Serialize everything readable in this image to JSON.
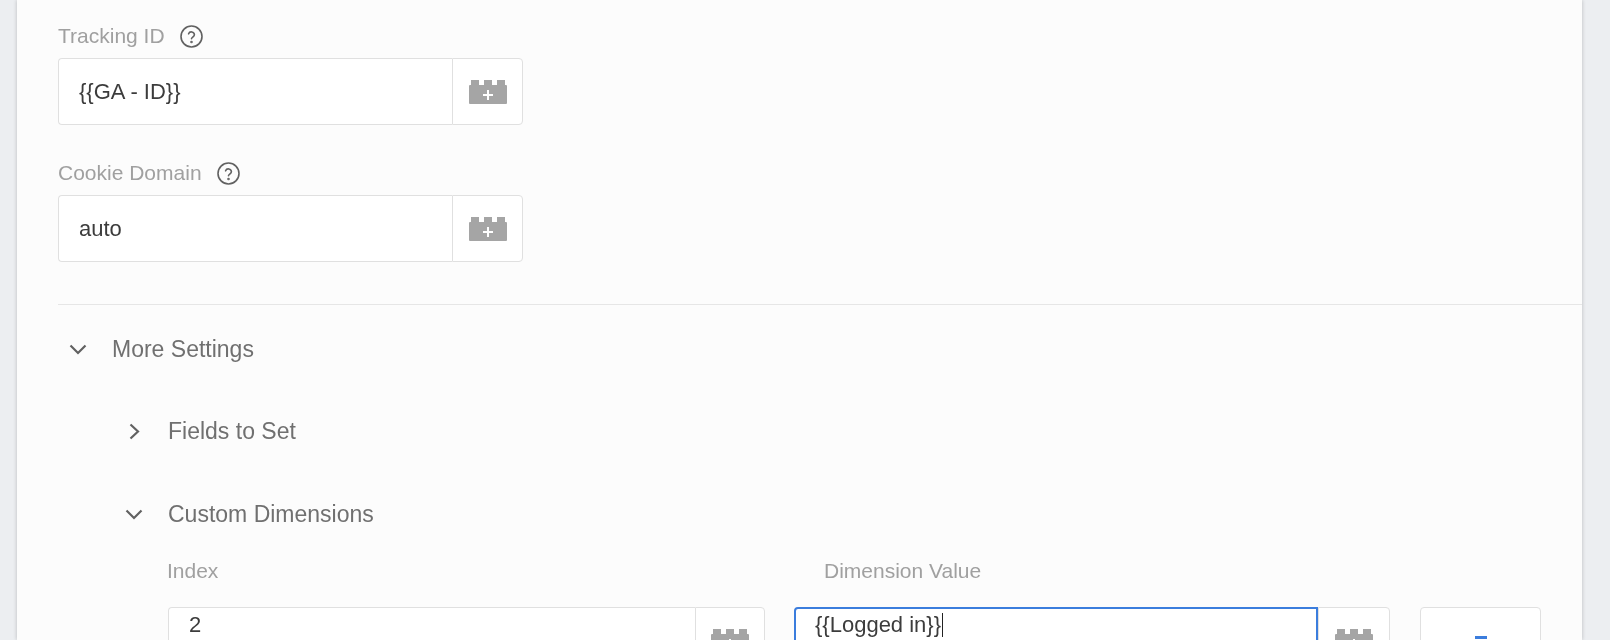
{
  "fields": [
    {
      "label": "Tracking ID",
      "value": "{{GA - ID}}"
    },
    {
      "label": "Cookie Domain",
      "value": "auto"
    }
  ],
  "more_settings": {
    "label": "More Settings",
    "expanded": true,
    "sections": [
      {
        "label": "Fields to Set",
        "expanded": false
      },
      {
        "label": "Custom Dimensions",
        "expanded": true,
        "columns": [
          "Index",
          "Dimension Value"
        ],
        "rows": [
          {
            "index": {
              "value": "2",
              "focused": false
            },
            "dimension_value": {
              "value": "{{Logged in}}",
              "focused": true
            }
          }
        ]
      }
    ]
  }
}
